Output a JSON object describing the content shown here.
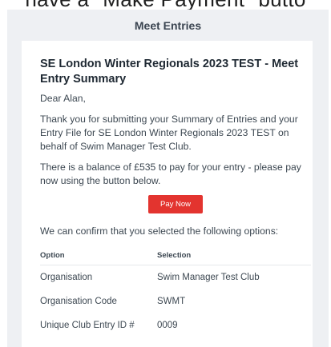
{
  "banner_text": "have a \"Make Payment\" butto",
  "header": {
    "title": "Meet Entries"
  },
  "email": {
    "title": "SE London Winter Regionals 2023 TEST - Meet Entry Summary",
    "greeting": "Dear Alan,",
    "para1": "Thank you for submitting your Summary of Entries and your Entry File for SE London Winter Regionals 2023 TEST on behalf of Swim Manager Test Club.",
    "para2": "There is a balance of £535 to pay for your entry - please pay now using the button below.",
    "pay_button_label": "Pay Now",
    "para3": "We can confirm that you selected the following options:",
    "table": {
      "headers": [
        "Option",
        "Selection"
      ],
      "rows": [
        [
          "Organisation",
          "Swim Manager Test Club"
        ],
        [
          "Organisation Code",
          "SWMT"
        ],
        [
          "Unique Club Entry ID #",
          "0009"
        ]
      ]
    }
  },
  "colors": {
    "background": "#eef0f3",
    "pay_button": "#e3342f"
  }
}
